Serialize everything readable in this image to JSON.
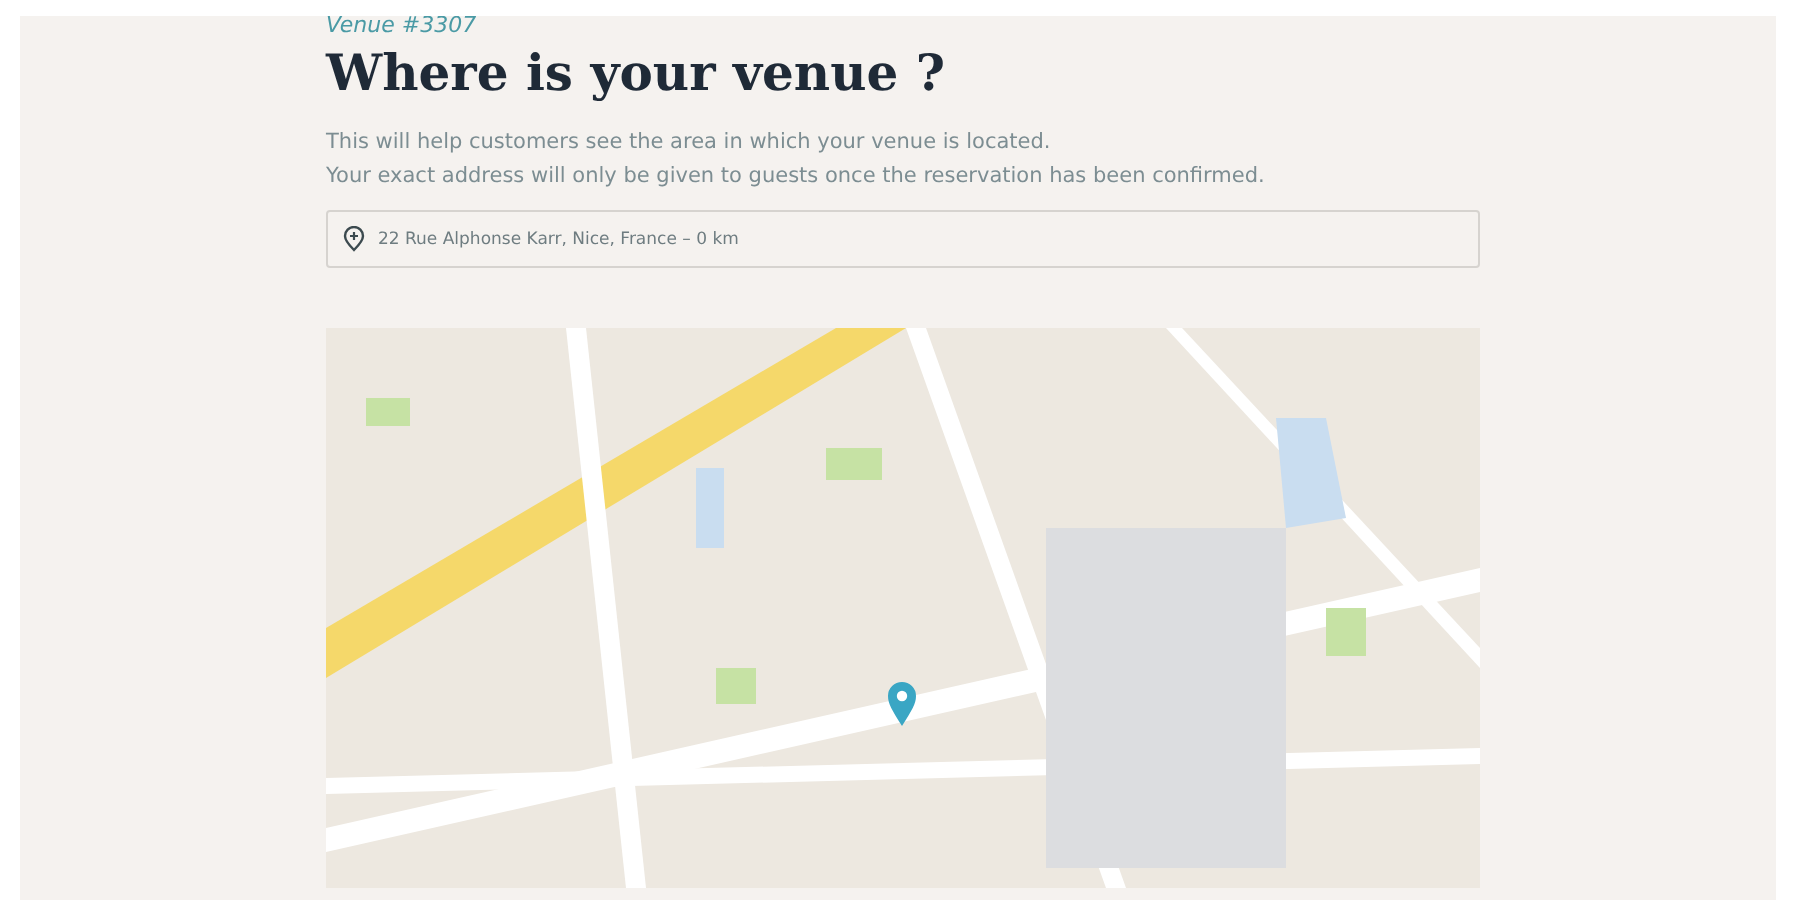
{
  "venue_label": "Venue #3307",
  "title": "Where is your venue ?",
  "description": [
    "This will help customers see the area in which your venue is located.",
    "Your exact address will only be given to guests once the reservation has been confirmed."
  ],
  "location_field": {
    "value": "22 Rue Alphonse Karr, Nice, France – 0 km"
  }
}
